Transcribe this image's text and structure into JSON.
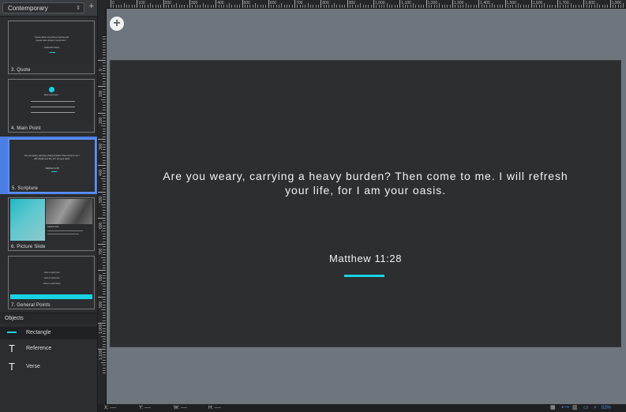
{
  "theme": {
    "name": "Contemporary",
    "add": "+"
  },
  "slides": [
    {
      "label": "3. Quote",
      "lines": [
        "\"I quote about something inspiring and",
        "people have shown it some here.\"",
        "- Attribution Name"
      ]
    },
    {
      "label": "4. Main Point",
      "lines": [
        "Main point here"
      ]
    },
    {
      "label": "5. Scripture",
      "lines": [
        "Are you weary, carrying a heavy burden? Then come to me. I",
        "will refresh your life, for I am your oasis.",
        "Matthew 11:28"
      ]
    },
    {
      "label": "6. Picture Slide",
      "lines": [
        "Caption here"
      ]
    },
    {
      "label": "7. General Points",
      "lines": [
        "- Here is point one",
        "- Here is point two",
        "- Here is point three"
      ]
    }
  ],
  "objects": {
    "header": "Objects",
    "items": [
      {
        "name": "Rectangle",
        "icon": "line-icon"
      },
      {
        "name": "Reference",
        "icon": "text-icon"
      },
      {
        "name": "Verse",
        "icon": "text-icon"
      }
    ]
  },
  "ruler": {
    "top": [
      "0",
      "100",
      "200",
      "300",
      "400",
      "500",
      "600",
      "700",
      "800",
      "900",
      "1,000",
      "1,100",
      "1,200",
      "1,300",
      "1,400",
      "1,500",
      "1,600",
      "1,700",
      "1,800",
      "1,900"
    ],
    "left": [
      "0",
      "100",
      "200",
      "300",
      "400",
      "500",
      "600",
      "700",
      "800",
      "900",
      "1,000",
      "1,100"
    ]
  },
  "slide": {
    "verse": "Are you weary, carrying a heavy burden? Then come to me. I will refresh your life, for I am your oasis.",
    "reference": "Matthew 11:28",
    "accent_color": "#18d3e3",
    "background": "#2d2e30"
  },
  "status": {
    "x": "X: ----",
    "y": "Y: ----",
    "w": "W: ----",
    "h": "H: ----",
    "zoom": "53%"
  }
}
